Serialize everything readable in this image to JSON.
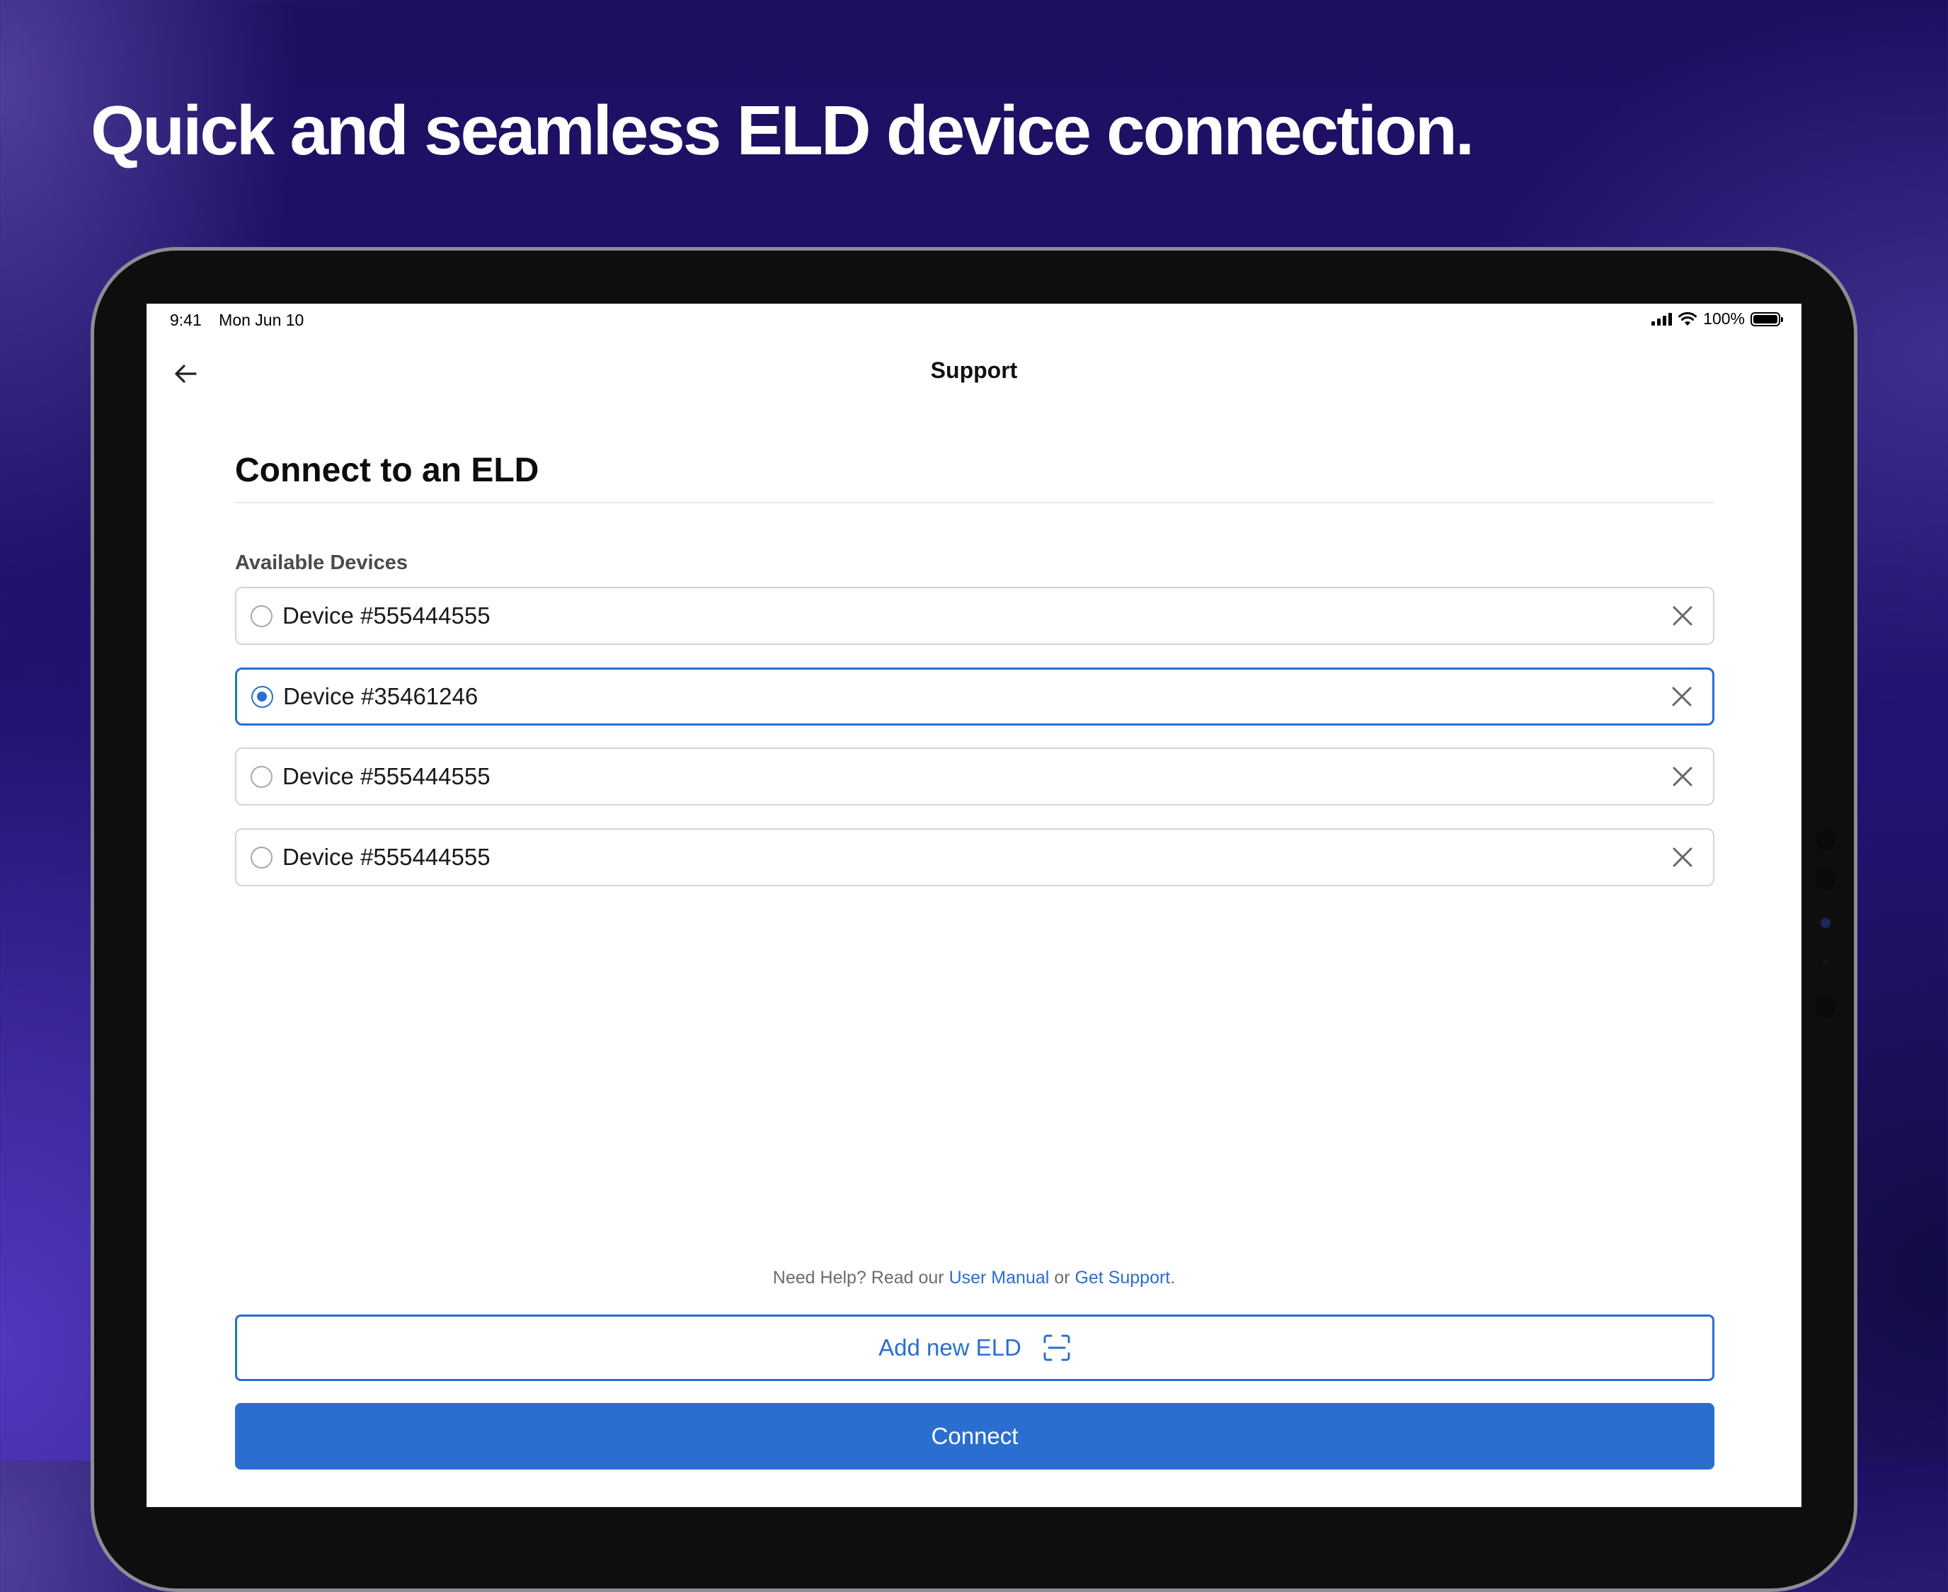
{
  "headline": "Quick and seamless ELD device connection.",
  "status_bar": {
    "time": "9:41",
    "date": "Mon Jun 10",
    "battery": "100%"
  },
  "nav": {
    "title": "Support",
    "back_icon": "arrow-left-icon"
  },
  "page": {
    "title": "Connect to an ELD",
    "list_label": "Available Devices"
  },
  "devices": [
    {
      "label": "Device #555444555",
      "selected": false
    },
    {
      "label": "Device #35461246",
      "selected": true
    },
    {
      "label": "Device #555444555",
      "selected": false
    },
    {
      "label": "Device #555444555",
      "selected": false
    }
  ],
  "help": {
    "prefix": "Need Help? Read our ",
    "manual_link": "User Manual",
    "middle": " or ",
    "support_link": "Get Support",
    "suffix": "."
  },
  "buttons": {
    "add_new": "Add new ELD",
    "add_new_icon": "scan-icon",
    "connect": "Connect"
  },
  "colors": {
    "accent": "#2a6fd0",
    "background": "#21126e"
  }
}
